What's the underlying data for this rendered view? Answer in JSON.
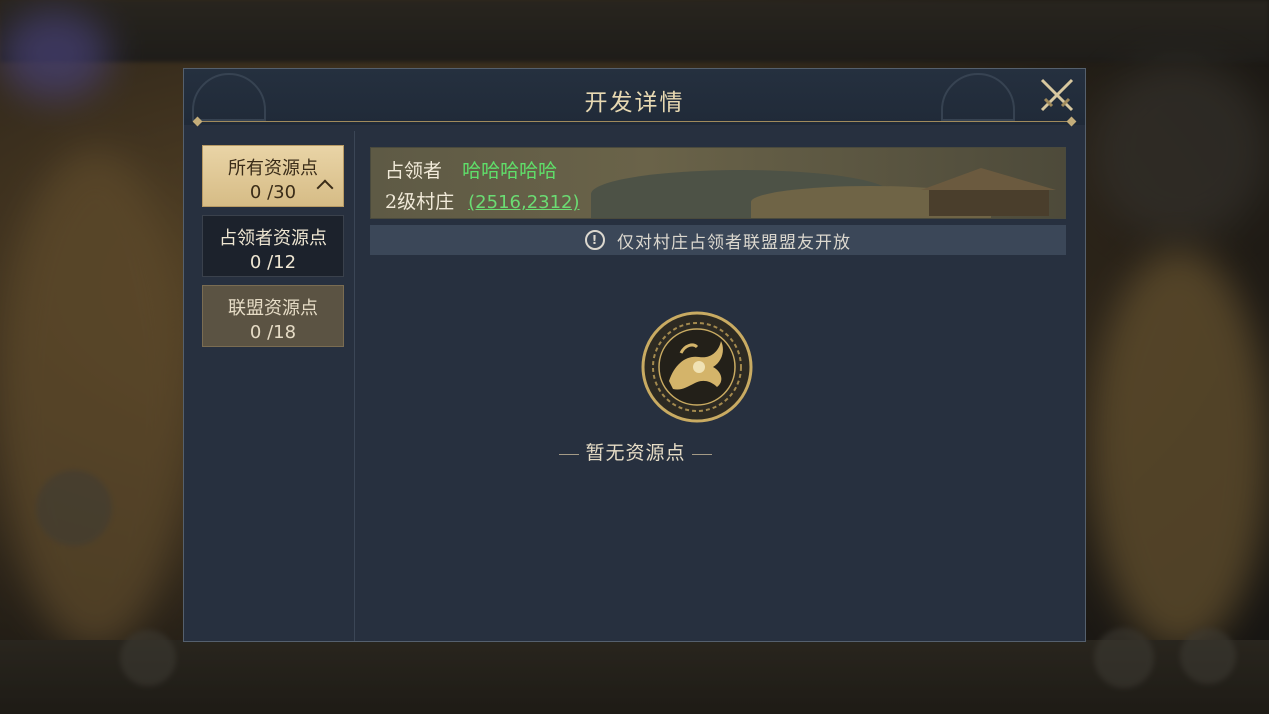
{
  "dialog": {
    "title": "开发详情"
  },
  "tabs": [
    {
      "label": "所有资源点",
      "count": "0 /30",
      "state": "active"
    },
    {
      "label": "占领者资源点",
      "count": "0 /12",
      "state": "default"
    },
    {
      "label": "联盟资源点",
      "count": "0 /18",
      "state": "default"
    }
  ],
  "banner": {
    "occupier_label": "占领者",
    "occupier_name": "哈哈哈哈哈",
    "village_level": "2级村庄",
    "coordinates": "(2516,2312)"
  },
  "notice": {
    "text": "仅对村庄占领者联盟盟友开放",
    "icon": "exclamation-icon"
  },
  "empty_state": {
    "text": "暂无资源点",
    "icon": "tiger-emblem-icon"
  },
  "colors": {
    "accent_gold": "#d6bc86",
    "green": "#5fe06a",
    "panel": "#27303f"
  }
}
